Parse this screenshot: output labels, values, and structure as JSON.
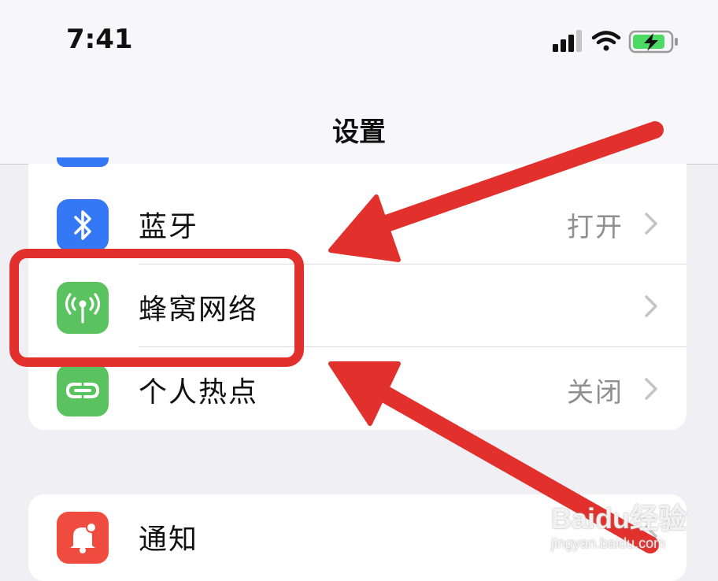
{
  "status_bar": {
    "time": "7:41",
    "icons": [
      "cellular-signal-icon",
      "wifi-icon",
      "battery-charging-icon"
    ]
  },
  "nav": {
    "title": "设置"
  },
  "colors": {
    "bluetooth": "#3478f6",
    "cellular": "#5ac35f",
    "hotspot": "#5ac35f",
    "notifications": "#ef4b3e",
    "annotation": "#e2302c"
  },
  "groups": [
    {
      "rows": [
        {
          "label": "蓝牙",
          "value": "打开",
          "icon": "bluetooth-icon"
        },
        {
          "label": "蜂窝网络",
          "value": "",
          "icon": "cellular-antenna-icon"
        },
        {
          "label": "个人热点",
          "value": "关闭",
          "icon": "personal-hotspot-icon"
        }
      ]
    },
    {
      "rows": [
        {
          "label": "通知",
          "value": "",
          "icon": "notification-bell-icon"
        }
      ]
    }
  ],
  "watermark": {
    "logo": "Baidu经验",
    "url": "jingyan.baidu.com"
  }
}
